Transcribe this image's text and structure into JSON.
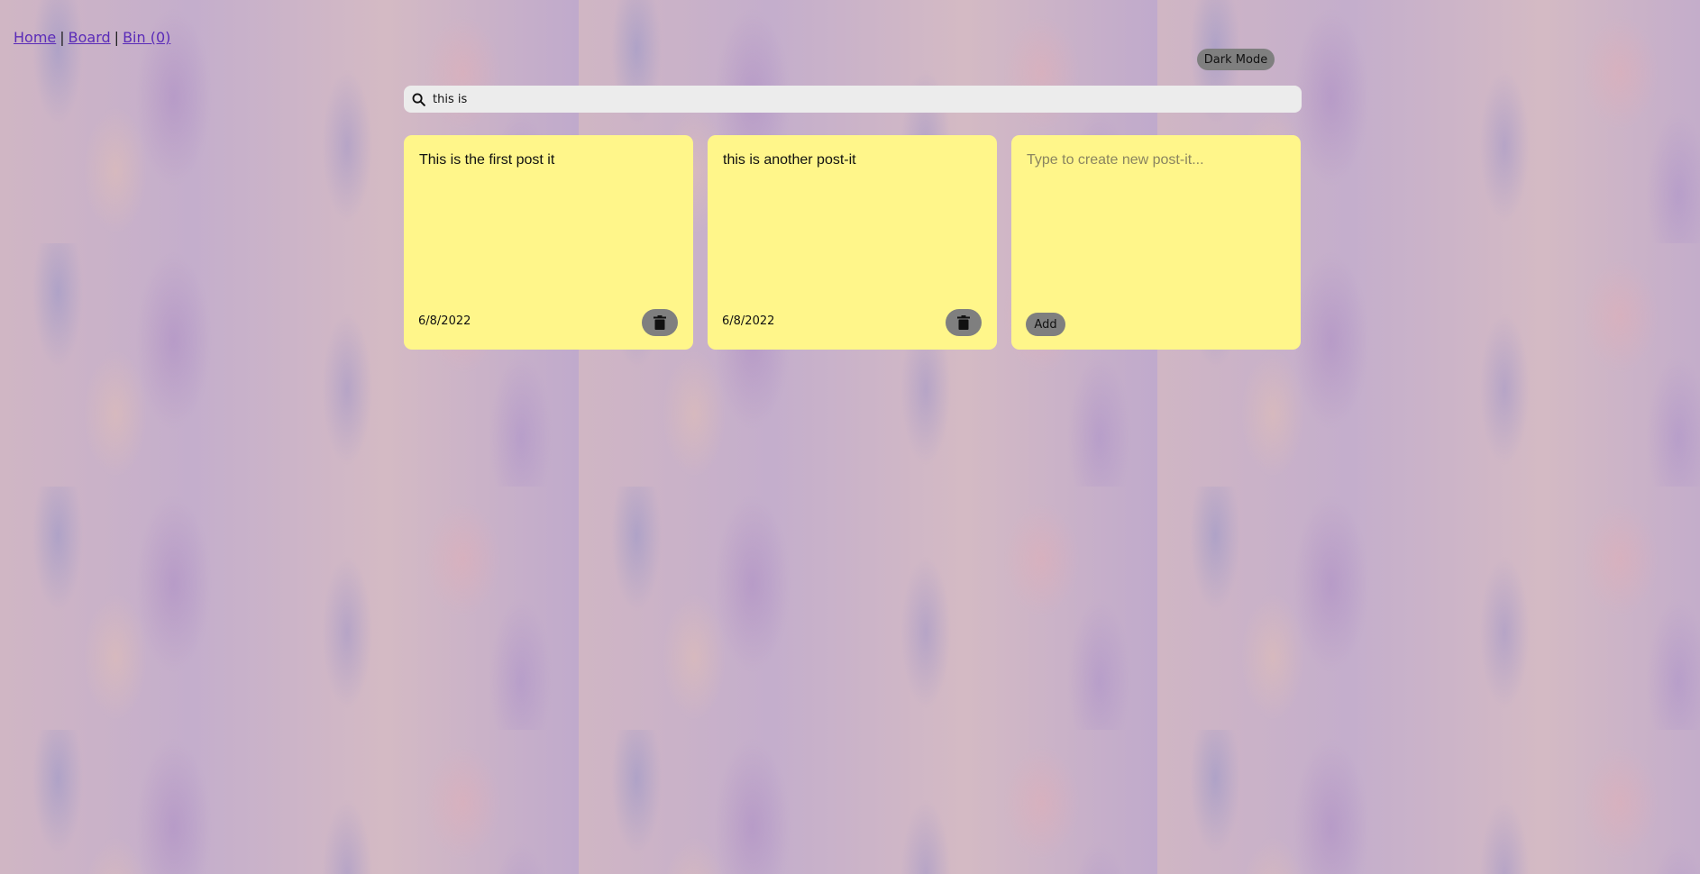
{
  "nav": {
    "home": "Home",
    "board": "Board",
    "bin": "Bin (0)",
    "separator": "|"
  },
  "theme_toggle": {
    "label": "Dark Mode"
  },
  "search": {
    "value": "this is",
    "icon": "search-icon"
  },
  "notes": [
    {
      "text": "This is the first post it",
      "date": "6/8/2022",
      "delete_icon": "trash-icon"
    },
    {
      "text": "this is another post-it",
      "date": "6/8/2022",
      "delete_icon": "trash-icon"
    }
  ],
  "new_note": {
    "placeholder": "Type to create new post-it...",
    "add_label": "Add"
  },
  "colors": {
    "note_background": "#fff68a",
    "button_gray": "#7f7f7f",
    "link": "#5a2bb8",
    "search_background": "#ececec"
  }
}
